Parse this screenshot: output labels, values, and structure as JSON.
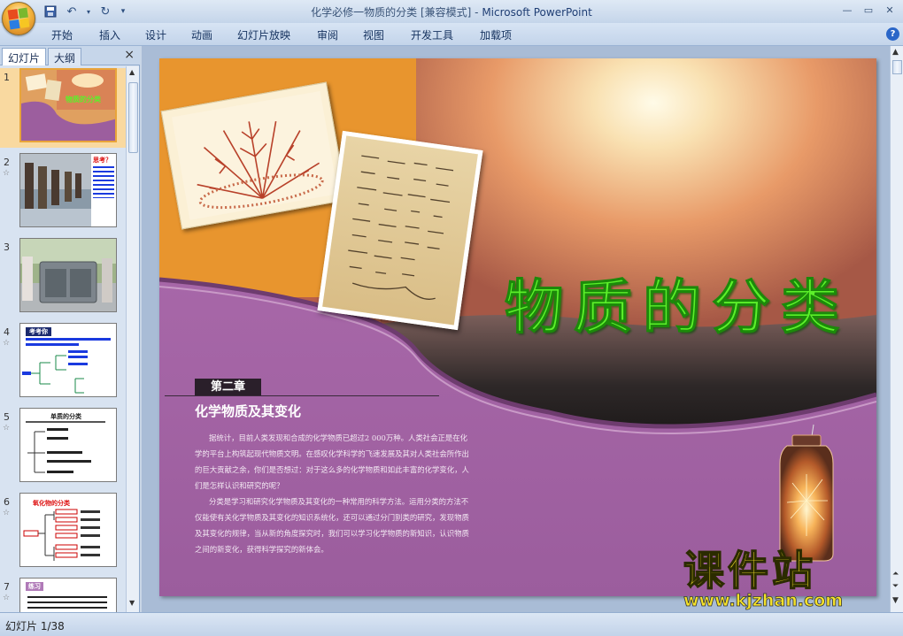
{
  "window": {
    "title_doc": "化学必修一物质的分类 [兼容模式]",
    "title_sep": " - ",
    "title_app": "Microsoft PowerPoint"
  },
  "ribbon": {
    "tabs": [
      "开始",
      "插入",
      "设计",
      "动画",
      "幻灯片放映",
      "审阅",
      "视图",
      "开发工具",
      "加载项"
    ]
  },
  "pane": {
    "tab_slides": "幻灯片",
    "tab_outline": "大纲",
    "close": "×"
  },
  "thumbnails": [
    {
      "num": "1",
      "title": "物质的分类"
    },
    {
      "num": "2",
      "title": "思考？"
    },
    {
      "num": "3",
      "title": ""
    },
    {
      "num": "4",
      "title": "考考你"
    },
    {
      "num": "5",
      "title": "单质的分类"
    },
    {
      "num": "6",
      "title": "氧化物的分类"
    },
    {
      "num": "7",
      "title": "练习"
    }
  ],
  "slide": {
    "title": "物质的分类",
    "chapter": "第二章",
    "subtitle": "化学物质及其变化",
    "body_p1": "据统计，目前人类发现和合成的化学物质已超过2 000万种。人类社会正是在化学的平台上构筑起现代物质文明。在感叹化学科学的飞速发展及其对人类社会所作出的巨大贡献之余，你们是否想过：对于这么多的化学物质和如此丰富的化学变化，人们是怎样认识和研究的呢？",
    "body_p2": "分类是学习和研究化学物质及其变化的一种常用的科学方法。运用分类的方法不仅能使有关化学物质及其变化的知识系统化，还可以通过分门别类的研究，发现物质及其变化的规律，当从新的角度探究时，我们可以学习化学物质的新知识，认识物质之间的新变化，获得科学探究的新体会。"
  },
  "watermark": {
    "main": "课件站",
    "url": "www.kjzhan.com"
  },
  "status": {
    "slide_indicator": "幻灯片 1/38"
  },
  "colors": {
    "title_green": "#5cf02a",
    "purple": "#9d5f9f",
    "accent_orange": "#e6902a"
  }
}
